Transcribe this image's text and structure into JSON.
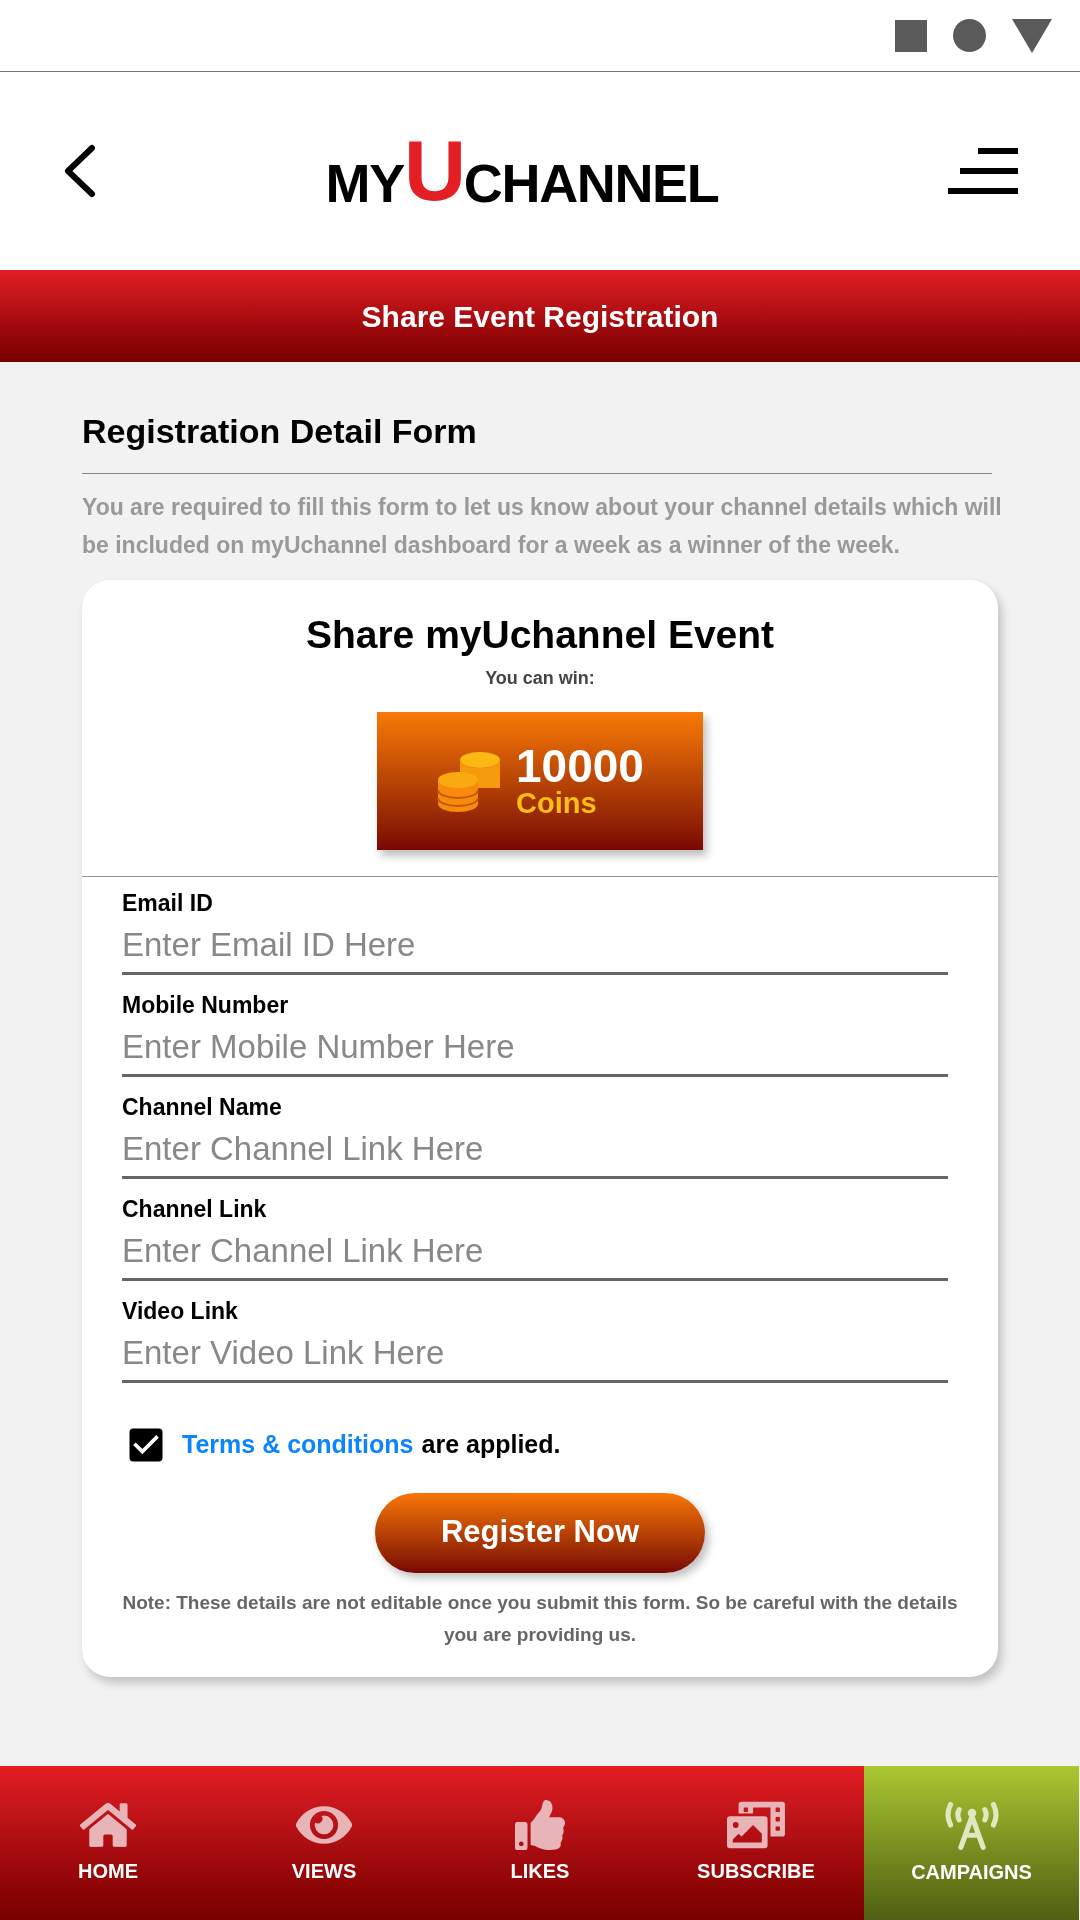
{
  "logo": [
    {
      "text": "MY",
      "kind": "plain"
    },
    {
      "text": "U",
      "kind": "accent"
    },
    {
      "text": "CHANNEL",
      "kind": "plain"
    }
  ],
  "banner": "Share Event Registration",
  "form_title": "Registration Detail Form",
  "description": "You are required to fill this form to let us know about your channel details which will be included on myUchannel dashboard for a week as a winner of the week.",
  "card": {
    "title": "Share myUchannel Event",
    "subtitle": "You can win:",
    "prize_amount": "10000",
    "prize_unit": "Coins"
  },
  "fields": [
    {
      "label": "Email ID",
      "placeholder": "Enter Email ID Here"
    },
    {
      "label": "Mobile Number",
      "placeholder": "Enter Mobile Number Here"
    },
    {
      "label": "Channel Name",
      "placeholder": "Enter Channel Link Here"
    },
    {
      "label": "Channel Link",
      "placeholder": "Enter Channel Link Here"
    },
    {
      "label": "Video Link",
      "placeholder": "Enter Video Link Here"
    }
  ],
  "terms": {
    "checked": true,
    "link": "Terms & conditions",
    "text": "are applied."
  },
  "button": "Register Now",
  "note": "Note: These details are not editable once you submit this form. So be careful with the details you are providing us.",
  "nav": [
    {
      "label": "HOME",
      "kind": "home",
      "selected": false
    },
    {
      "label": "VIEWS",
      "kind": "views",
      "selected": false
    },
    {
      "label": "LIKES",
      "kind": "likes",
      "selected": false
    },
    {
      "label": "SUBSCRIBE",
      "kind": "subscribe",
      "selected": false
    },
    {
      "label": "CAMPAIGNS",
      "kind": "campaigns",
      "selected": true
    }
  ]
}
